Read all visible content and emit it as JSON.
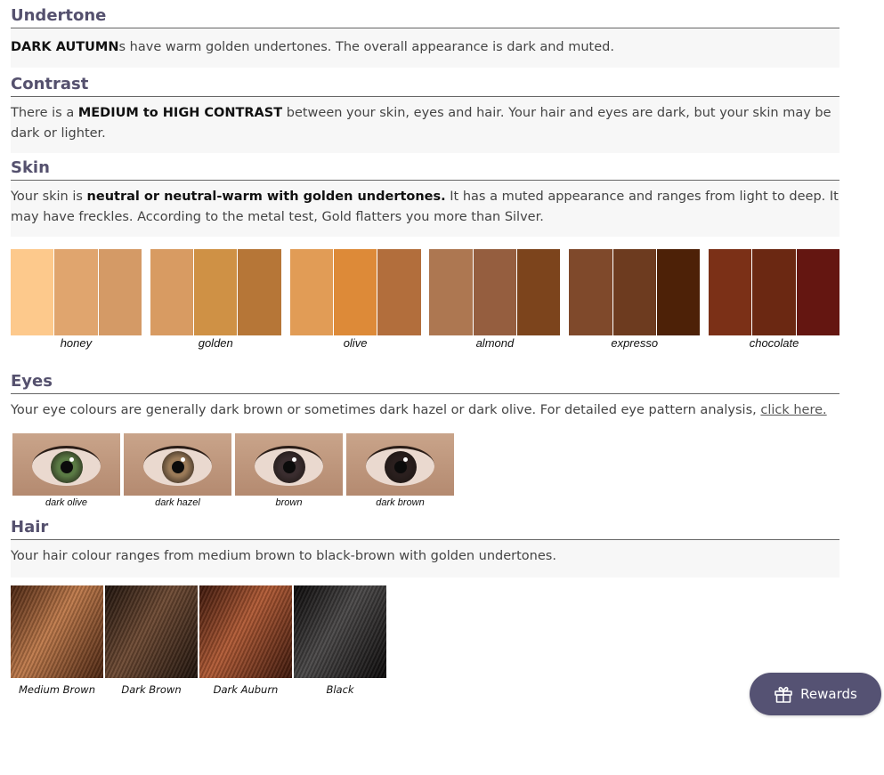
{
  "undertone": {
    "heading": "Undertone",
    "bold": "DARK AUTUMN",
    "text": "s have warm golden undertones. The overall appearance is dark and muted."
  },
  "contrast": {
    "heading": "Contrast",
    "text_before": "There is a ",
    "bold": "MEDIUM to HIGH CONTRAST",
    "text_after": " between your skin, eyes and hair. Your hair and eyes are dark, but your skin may be dark or lighter."
  },
  "skin": {
    "heading": "Skin",
    "text_before": "Your skin is ",
    "bold": "neutral or neutral-warm with golden undertones.",
    "text_after": " It has a muted appearance and ranges from light to deep. It may have freckles. According to the metal test, Gold flatters you more than Silver.",
    "swatches": [
      {
        "label": "honey",
        "colors": [
          "#fdc98c",
          "#e0a56e",
          "#d49a66"
        ]
      },
      {
        "label": "golden",
        "colors": [
          "#d89b62",
          "#cf9145",
          "#b67637"
        ]
      },
      {
        "label": "olive",
        "colors": [
          "#e19c56",
          "#dd8a38",
          "#b26e3c"
        ]
      },
      {
        "label": "almond",
        "colors": [
          "#ad7751",
          "#955e3f",
          "#7c441c"
        ]
      },
      {
        "label": "expresso",
        "colors": [
          "#7f492b",
          "#6d3b1f",
          "#4d2107"
        ]
      },
      {
        "label": "chocolate",
        "colors": [
          "#7b3017",
          "#6b2812",
          "#641611"
        ]
      }
    ]
  },
  "eyes": {
    "heading": "Eyes",
    "text": "Your eye colours are generally dark brown or sometimes dark hazel or dark olive. For detailed eye pattern analysis, ",
    "link": "click here.",
    "items": [
      {
        "label": "dark olive",
        "iris": "#5a7a44"
      },
      {
        "label": "dark hazel",
        "iris": "#9a7a58"
      },
      {
        "label": "brown",
        "iris": "#3a2d2f"
      },
      {
        "label": "dark brown",
        "iris": "#2a1f1e"
      }
    ]
  },
  "hair": {
    "heading": "Hair",
    "text": "Your hair colour ranges from medium brown to black-brown with golden undertones.",
    "items": [
      {
        "label": "Medium Brown",
        "light": "#c07a4a",
        "dark": "#4a2410"
      },
      {
        "label": "Dark Brown",
        "light": "#6e4a33",
        "dark": "#1e120b"
      },
      {
        "label": "Dark Auburn",
        "light": "#b25a34",
        "dark": "#3c160a"
      },
      {
        "label": "Black",
        "light": "#4a4848",
        "dark": "#0a0808"
      }
    ]
  },
  "rewards": {
    "label": "Rewards"
  }
}
